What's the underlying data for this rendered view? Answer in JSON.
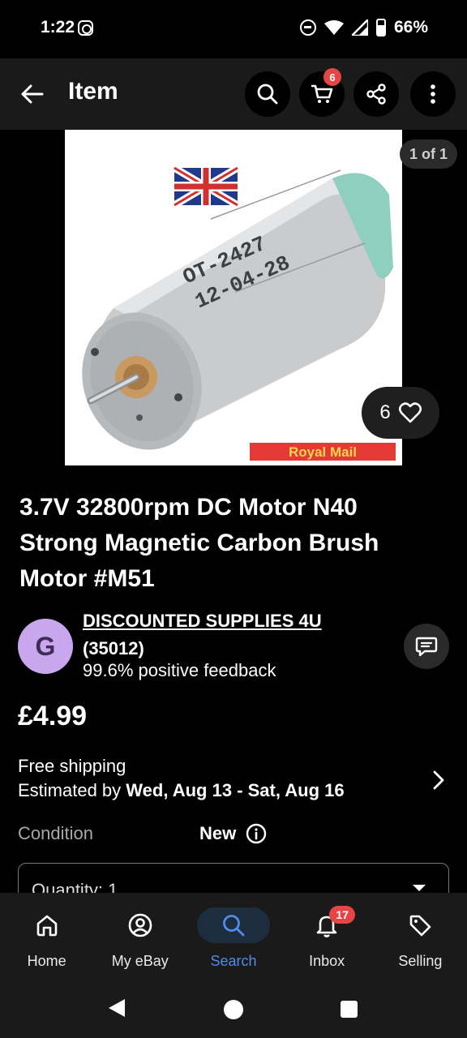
{
  "status_bar": {
    "time": "1:22",
    "battery": "66%"
  },
  "header": {
    "title": "Item",
    "cart_count": "6"
  },
  "gallery": {
    "counter": "1 of 1",
    "watch_count": "6",
    "image_texts": {
      "model": "OT-2427",
      "date": "12-04-28",
      "shipping_banner": "Royal Mail"
    }
  },
  "item": {
    "title": "3.7V 32800rpm DC Motor N40 Strong Magnetic Carbon Brush Motor #M51",
    "price": "£4.99"
  },
  "seller": {
    "avatar_letter": "G",
    "name": "DISCOUNTED SUPPLIES 4U",
    "feedback_count": "(35012)",
    "feedback_percent": "99.6% positive feedback"
  },
  "shipping": {
    "line1": "Free shipping",
    "estimate_prefix": "Estimated by ",
    "estimate_dates": "Wed, Aug 13 - Sat, Aug 16"
  },
  "condition": {
    "label": "Condition",
    "value": "New"
  },
  "quantity": {
    "label": "Quantity: 1"
  },
  "bottom_nav": {
    "items": [
      {
        "label": "Home",
        "icon": "home-icon"
      },
      {
        "label": "My eBay",
        "icon": "account-icon"
      },
      {
        "label": "Search",
        "icon": "search-icon",
        "active": true
      },
      {
        "label": "Inbox",
        "icon": "bell-icon",
        "badge": "17"
      },
      {
        "label": "Selling",
        "icon": "tag-icon"
      }
    ]
  },
  "colors": {
    "accent": "#4f8de8",
    "badge": "#e64545",
    "avatar": "#c9a7ee",
    "surface": "#1a1a1a"
  }
}
